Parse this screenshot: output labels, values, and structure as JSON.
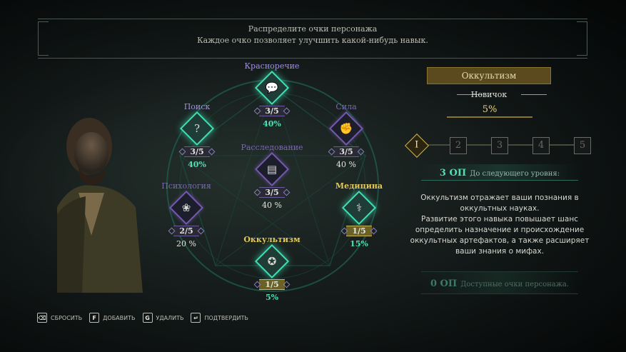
{
  "banner": {
    "line1": "Распределите очки персонажа",
    "line2": "Каждое очко позволяет улучшить какой-нибудь навык."
  },
  "skills": [
    {
      "name": "Красноречие",
      "level": "3/5",
      "percent": "40%",
      "icon": "speech-bubbles-icon"
    },
    {
      "name": "Поиск",
      "level": "3/5",
      "percent": "40%",
      "icon": "question-mark-icon"
    },
    {
      "name": "Сила",
      "level": "3/5",
      "percent": "40 %",
      "icon": "fist-icon"
    },
    {
      "name": "Расследование",
      "level": "3/5",
      "percent": "40 %",
      "icon": "document-icon"
    },
    {
      "name": "Психология",
      "level": "2/5",
      "percent": "20 %",
      "icon": "brain-icon"
    },
    {
      "name": "Медицина",
      "level": "1/5",
      "percent": "15%",
      "icon": "caduceus-icon"
    },
    {
      "name": "Оккультизм",
      "level": "1/5",
      "percent": "5%",
      "icon": "occult-symbol-icon"
    }
  ],
  "detail": {
    "title": "Оккультизм",
    "rank": "Новичок",
    "percent": "5%",
    "levels": [
      "I",
      "2",
      "3",
      "4",
      "5"
    ],
    "active_level": "I",
    "xp_value": "3 ОП",
    "xp_label": "До следующего уровня:",
    "description1": "Оккультизм отражает ваши познания в оккультных науках.",
    "description2": "Развитие этого навыка повышает шанс определить назначение и происхождение оккультных артефактов, а также расширяет ваши знания о мифах.",
    "points_value": "0 ОП",
    "points_label": "Доступные очки персонажа."
  },
  "controls": [
    {
      "key": "⌫",
      "label": "СБРОСИТЬ"
    },
    {
      "key": "F",
      "label": "ДОБАВИТЬ"
    },
    {
      "key": "G",
      "label": "УДАЛИТЬ"
    },
    {
      "key": "↵",
      "label": "ПОДТВЕРДИТЬ"
    }
  ],
  "colors": {
    "teal": "#3fe0b3",
    "purple": "#7559b0",
    "gold": "#c9b457"
  }
}
